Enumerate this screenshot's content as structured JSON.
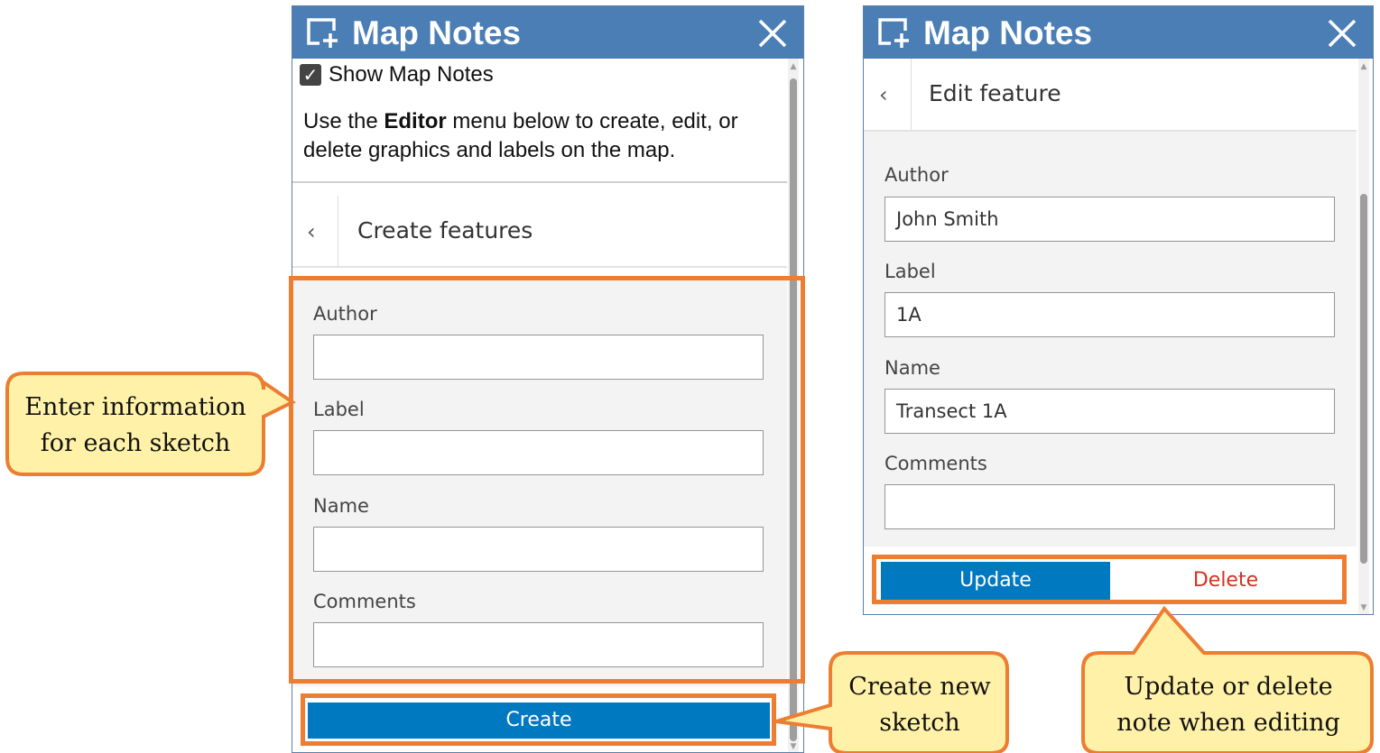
{
  "left_panel": {
    "title": "Map Notes",
    "show_notes_checked": true,
    "show_notes_label": "Show Map Notes",
    "instructions": {
      "pre": "Use the ",
      "bold": "Editor",
      "post": " menu below to create, edit, or delete graphics and labels on the map."
    },
    "section_title": "Create features",
    "fields": [
      {
        "label": "Author",
        "value": ""
      },
      {
        "label": "Label",
        "value": ""
      },
      {
        "label": "Name",
        "value": ""
      },
      {
        "label": "Comments",
        "value": ""
      }
    ],
    "create_label": "Create"
  },
  "right_panel": {
    "title": "Map Notes",
    "section_title": "Edit feature",
    "fields": [
      {
        "label": "Author",
        "value": "John Smith"
      },
      {
        "label": "Label",
        "value": "1A"
      },
      {
        "label": "Name",
        "value": "Transect 1A"
      },
      {
        "label": "Comments",
        "value": ""
      }
    ],
    "update_label": "Update",
    "delete_label": "Delete"
  },
  "callouts": {
    "enter_info": [
      "Enter information",
      "for each sketch"
    ],
    "create_new": [
      "Create new",
      "sketch"
    ],
    "update_delete": [
      "Update or delete",
      "note when editing"
    ]
  },
  "colors": {
    "header": "#4a7eb4",
    "primary_button": "#0079c1",
    "delete_text": "#d83020",
    "highlight": "#ed7d31",
    "callout_fill": "#fff2a8"
  },
  "icons": {
    "title": "add-map-note-icon",
    "close": "close-icon",
    "back": "chevron-left-icon",
    "checkbox": "checkbox-checked-icon"
  }
}
